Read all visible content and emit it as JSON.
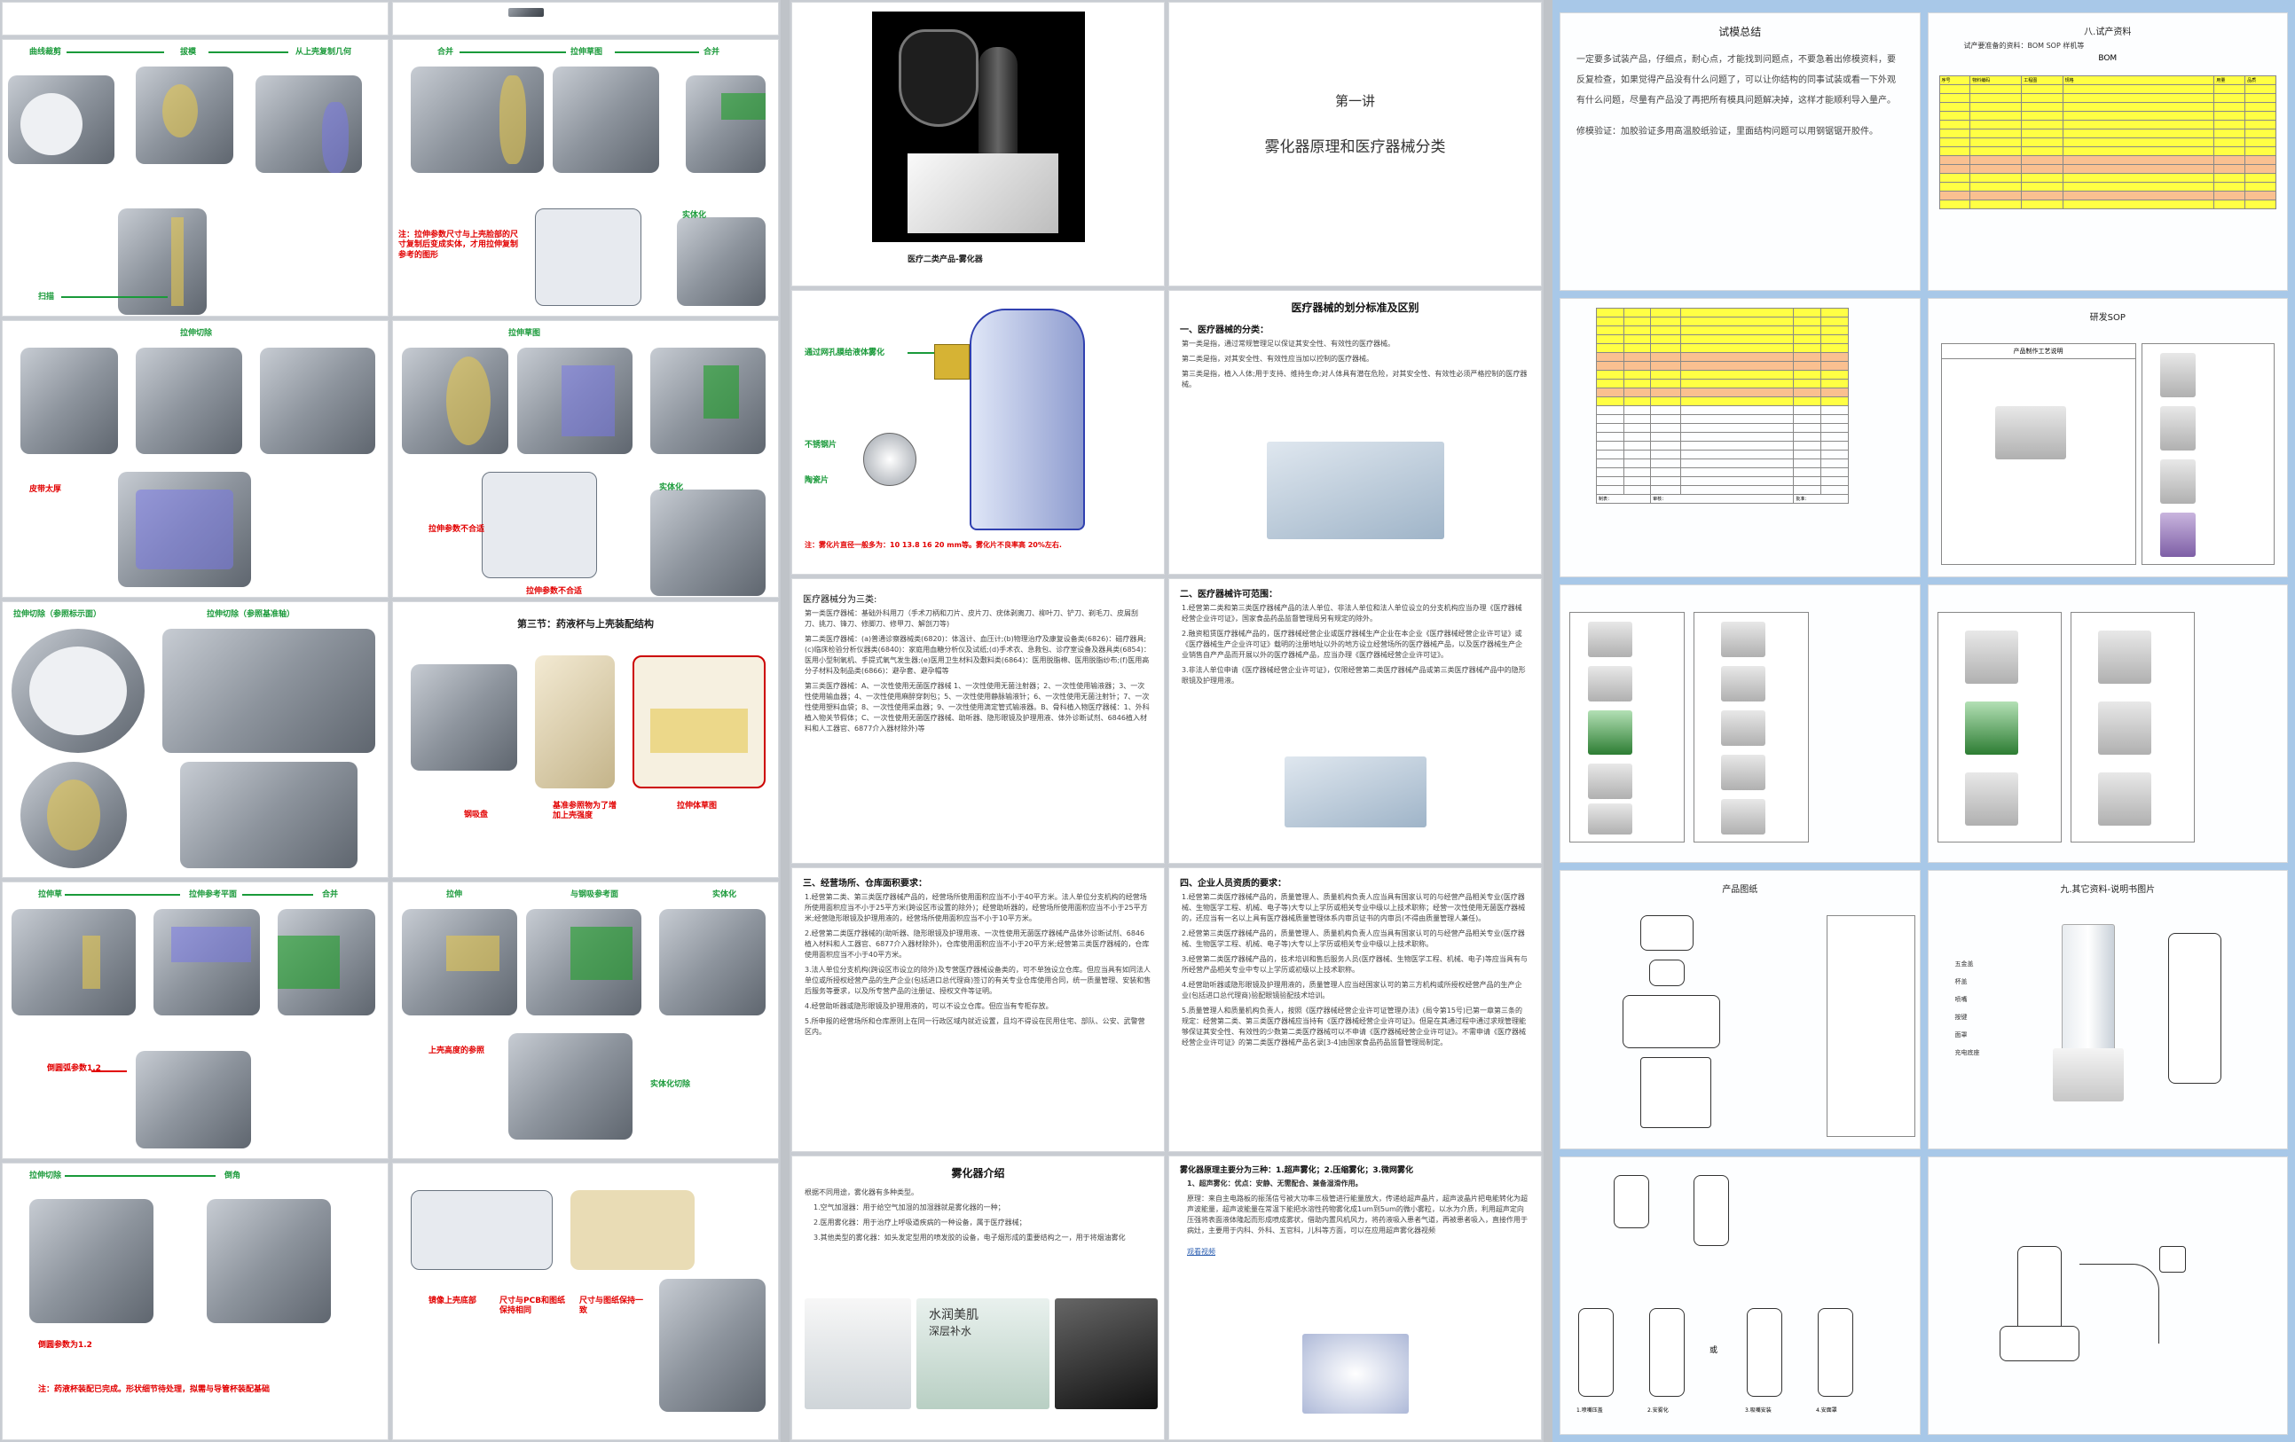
{
  "left": {
    "p2": {
      "labels": [
        "曲线裁剪",
        "拔模",
        "从上壳复制几何"
      ],
      "note": "扫描"
    },
    "p3": {
      "labels": [
        "合并",
        "拉伸草图",
        "合并"
      ],
      "note": "注：拉伸参数尺寸与上壳脸部的尺寸复制后变成实体，才用拉伸复制参考的图形",
      "final": "实体化"
    },
    "p4": {
      "labels": [
        "拉伸切除"
      ],
      "note": "皮带太厚"
    },
    "p5": {
      "labels": [
        "拉伸草图"
      ],
      "note1": "拉伸参数不合适",
      "note2": "拉伸参数不合适",
      "final": "实体化"
    },
    "p6": {
      "labels": [
        "拉伸切除（参照标示面）",
        "拉伸切除（参照基准轴）"
      ]
    },
    "p7": {
      "title": "第三节：药液杯与上壳装配结构",
      "notes": [
        "钢吸盘",
        "基准参照物为了增加上壳强度",
        "拉伸体草图"
      ]
    },
    "p8": {
      "labels": [
        "拉伸草",
        "拉伸参考平面",
        "合并"
      ],
      "note": "倒圆弧参数1.2"
    },
    "p9": {
      "labels": [
        "拉伸",
        "与钢吸参考面",
        "实体化"
      ],
      "note1": "上壳高度的参照",
      "note2": "实体化切除"
    },
    "p10": {
      "labels": [
        "拉伸切除",
        "倒角"
      ],
      "note1": "倒圆参数为1.2",
      "note2": "注：药液杯装配已完成。形状细节待处理，拟需与导管杯装配基础"
    },
    "p11": {
      "note1": "镜像上壳底部",
      "note2": "尺寸与PCB和图纸保持相同",
      "note3": "尺寸与图纸保持一致"
    }
  },
  "mid": {
    "cover": {
      "caption": "医疗二类产品-雾化器"
    },
    "lecture": {
      "kicker": "第一讲",
      "title": "雾化器原理和医疗器械分类"
    },
    "device": {
      "label1": "通过网孔膜给液体雾化",
      "label2": "不锈钢片",
      "label3": "陶瓷片",
      "note": "注：雾化片直径一般多为：10 13.8 16 20 mm等。雾化片不良率高 20%左右."
    },
    "classify": {
      "title": "医疗器械的划分标准及区别",
      "head": "一、医疗器械的分类：",
      "p1": "第一类是指，通过常规管理足以保证其安全性、有效性的医疗器械。",
      "p2": "第二类是指，对其安全性、有效性应当加以控制的医疗器械。",
      "p3": "第三类是指，植入人体;用于支持、维持生命;对人体具有潜在危险，对其安全性、有效性必须严格控制的医疗器械。"
    },
    "three_class": {
      "head": "医疗器械分为三类:",
      "p1": "第一类医疗器械：基础外科用刀（手术刀柄和刀片、皮片刀、疣体剥离刀、柳叶刀、铲刀、剃毛刀、皮屑刮刀、挑刀、锋刀、修脚刀、修甲刀、解剖刀等)",
      "p2": "第二类医疗器械：(a)普通诊察器械类(6820)：体温计、血压计;(b)物理治疗及康复设备类(6826)：磁疗器具;(c)临床检验分析仪器类(6840)：家庭用血糖分析仪及试纸;(d)手术衣、急救包、诊疗室设备及器具类(6854)：医用小型制氧机、手提式氧气发生器;(e)医用卫生材料及敷料类(6864)：医用脱脂棉、医用脱脂纱布;(f)医用高分子材料及制品类(6866)：避孕套、避孕帽等",
      "p3": "第三类医疗器械：A、一次性使用无菌医疗器械 1、一次性使用无菌注射器；2、一次性使用输液器；3、一次性使用输血器；4、一次性使用麻醉穿刺包；5、一次性使用静脉输液针；6、一次性使用无菌注射针；7、一次性使用塑料血袋；8、一次性使用采血器；9、一次性使用滴定管式输液器。B、骨科植入物医疗器械：1、外科植入物关节假体；C、一次性使用无菌医疗器械、助听器、隐形眼镜及护理用液、体外诊断试剂、6846植入材料和人工器官、6877介入器材除外)等"
    },
    "license": {
      "head": "二、医疗器械许可范围：",
      "p1": "1.经营第二类和第三类医疗器械产品的法人单位、非法人单位和法人单位设立的分支机构应当办理《医疗器械经营企业许可证》，国家食品药品监督管理局另有规定的除外。",
      "p2": "2.融资租赁医疗器械产品的，医疗器械经营企业或医疗器械生产企业在本企业《医疗器械经营企业许可证》或《医疗器械生产企业许可证》载明的注册地址以外的地方设立经营场所的医疗器械产品，以及医疗器械生产企业销售自产产品而开展以外的医疗器械产品，应当办理《医疗器械经营企业许可证》。",
      "p3": "3.非法人单位申请《医疗器械经营企业许可证》，仅限经营第二类医疗器械产品或第三类医疗器械产品中的隐形眼镜及护理用液。"
    },
    "warehouse": {
      "head": "三、经营场所、仓库面积要求：",
      "p1": "1.经营第二类、第三类医疗器械产品的，经营场所使用面积应当不小于40平方米。法人单位分支机构的经营场所使用面积应当不小于25平方米(跨设区市设置的除外)；经营助听器的，经营场所使用面积应当不小于25平方米;经营隐形眼镜及护理用液的，经营场所使用面积应当不小于10平方米。",
      "p2": "2.经营第二类医疗器械的(助听器、隐形眼镜及护理用液、一次性使用无菌医疗器械产品体外诊断试剂、6846植入材料和人工器官、6877介入器材除外)，仓库使用面积应当不小于20平方米;经营第三类医疗器械的，仓库使用面积应当不小于40平方米。",
      "p3": "3.法人单位分支机构(跨设区市设立的除外)及专营医疗器械设备类的，可不单独设立仓库。但应当具有如同法人单位或所授权经营产品的生产企业(包括进口总代理商)签订的有关专业仓库使用合同，统一质量管理、安装和售后服务等要求，以及所专营产品的注册证、授权文件等证明。",
      "p4": "4.经营助听器或隐形眼镜及护理用液的，可以不设立仓库。但应当有专柜存放。",
      "p5": "5.所申报的经营场所和仓库原则上在同一行政区域内就近设置，且均不得设在民用住宅、部队、公安、武警营区内。"
    },
    "staff": {
      "head": "四、企业人员资质的要求：",
      "p1": "1.经营第二类医疗器械产品的，质量管理人、质量机构负责人应当具有国家认可的与经营产品相关专业(医疗器械、生物医学工程、机械、电子等)大专以上学历或相关专业中级以上技术职称；经营一次性使用无菌医疗器械的，还应当有一名以上具有医疗器械质量管理体系内审员证书的内审员(不得由质量管理人兼任)。",
      "p2": "2.经营第三类医疗器械产品的，质量管理人、质量机构负责人应当具有国家认可的与经营产品相关专业(医疗器械、生物医学工程、机械、电子等)大专以上学历或相关专业中级以上技术职称。",
      "p3": "3.经营第二类医疗器械产品的，技术培训和售后服务人员(医疗器械、生物医学工程、机械、电子)等应当具有与所经营产品相关专业中专以上学历或初级以上技术职称。",
      "p4": "4.经营助听器或隐形眼镜及护理用液的，质量管理人应当经国家认可的第三方机构或所授权经营产品的生产企业(包括进口总代理商)验配眼镜验配技术培训。",
      "p5": "5.质量管理人和质量机构负责人，按照《医疗器械经营企业许可证管理办法》(局令第15号)已第一章第三条的规定：经营第二类、第三类医疗器械应当持有《医疗器械经营企业许可证》。但是在其通过程中通过求规管理能够保证其安全性、有效性的少数第二类医疗器械可以不申请《医疗器械经营企业许可证》。不需申请《医疗器械经营企业许可证》的第二类医疗器械产品名录[3-4]由国家食品药品监督管理局制定。"
    },
    "intro": {
      "title": "雾化器介绍",
      "lead": "根据不同用途，雾化器有多种类型。",
      "items": [
        "1.空气加湿器：用于给空气加湿的加湿器就是雾化器的一种；",
        "2.医用雾化器：用于治疗上呼吸道疾病的一种设备，属于医疗器械；",
        "3.其他类型的雾化器：如头发定型用的喷发胶的设备，电子烟形成的重要结构之一，用于将烟油雾化"
      ],
      "promo1": "水润美肌",
      "promo2": "深层补水"
    },
    "principle": {
      "head": "雾化器原理主要分为三种：1.超声雾化；2.压缩雾化；3.微网雾化",
      "p1": "1、超声雾化：优点：安静、无需配合、兼备湿滑作用。",
      "p2": "原理：来自主电路板的振荡信号被大功率三极管进行能量放大，传递给超声晶片，超声波晶片把电能转化为超声波能量，超声波能量在常温下能把水溶性药物雾化成1um到5um的微小雾粒，以水为介质，利用超声定向压强将表面液体隆起而形成喷成雾状，借助内置风机风力，将药液吸入患者气道，再被患者吸入，直接作用于病灶，主要用于内科、外科、五官科，儿科等方面，可以在应用超声雾化器视频",
      "link": "观看视频"
    }
  },
  "right": {
    "summary": {
      "title": "试模总结",
      "p1": "一定要多试装产品，仔细点，耐心点，才能找到问题点，不要急着出修模资料，要反复检查，如果觉得产品没有什么问题了，可以让你结构的同事试装或看一下外观有什么问题，尽量有产品没了再把所有模具问题解决掉，这样才能顺利导入量产。",
      "p2": "修模验证：加胶验证多用高温胶纸验证，里面结构问题可以用钢锯锯开胶件。"
    },
    "bom": {
      "heading": "八.试产资料",
      "sub": "试产要准备的资料：BOM SOP 样机等",
      "label": "BOM",
      "headers": [
        "序号",
        "物料编码",
        "工程图",
        "规格",
        "用量",
        "品质"
      ],
      "footer": [
        "制表：",
        "审核：",
        "批准："
      ]
    },
    "sop": {
      "title": "研发SOP",
      "form_title": "产品制作工艺说明"
    },
    "parts": {
      "title": "产品图纸"
    },
    "manual": {
      "title": "九.其它资料-说明书图片",
      "labels": [
        "五金盖",
        "杯盖",
        "喷嘴",
        "按键",
        "面罩",
        "充电底座"
      ]
    },
    "lineart": {
      "labels": [
        "1.喷嘴压盖",
        "2.安雾化",
        "3.吸嘴安装",
        "4.安面罩"
      ],
      "or": "或"
    }
  }
}
